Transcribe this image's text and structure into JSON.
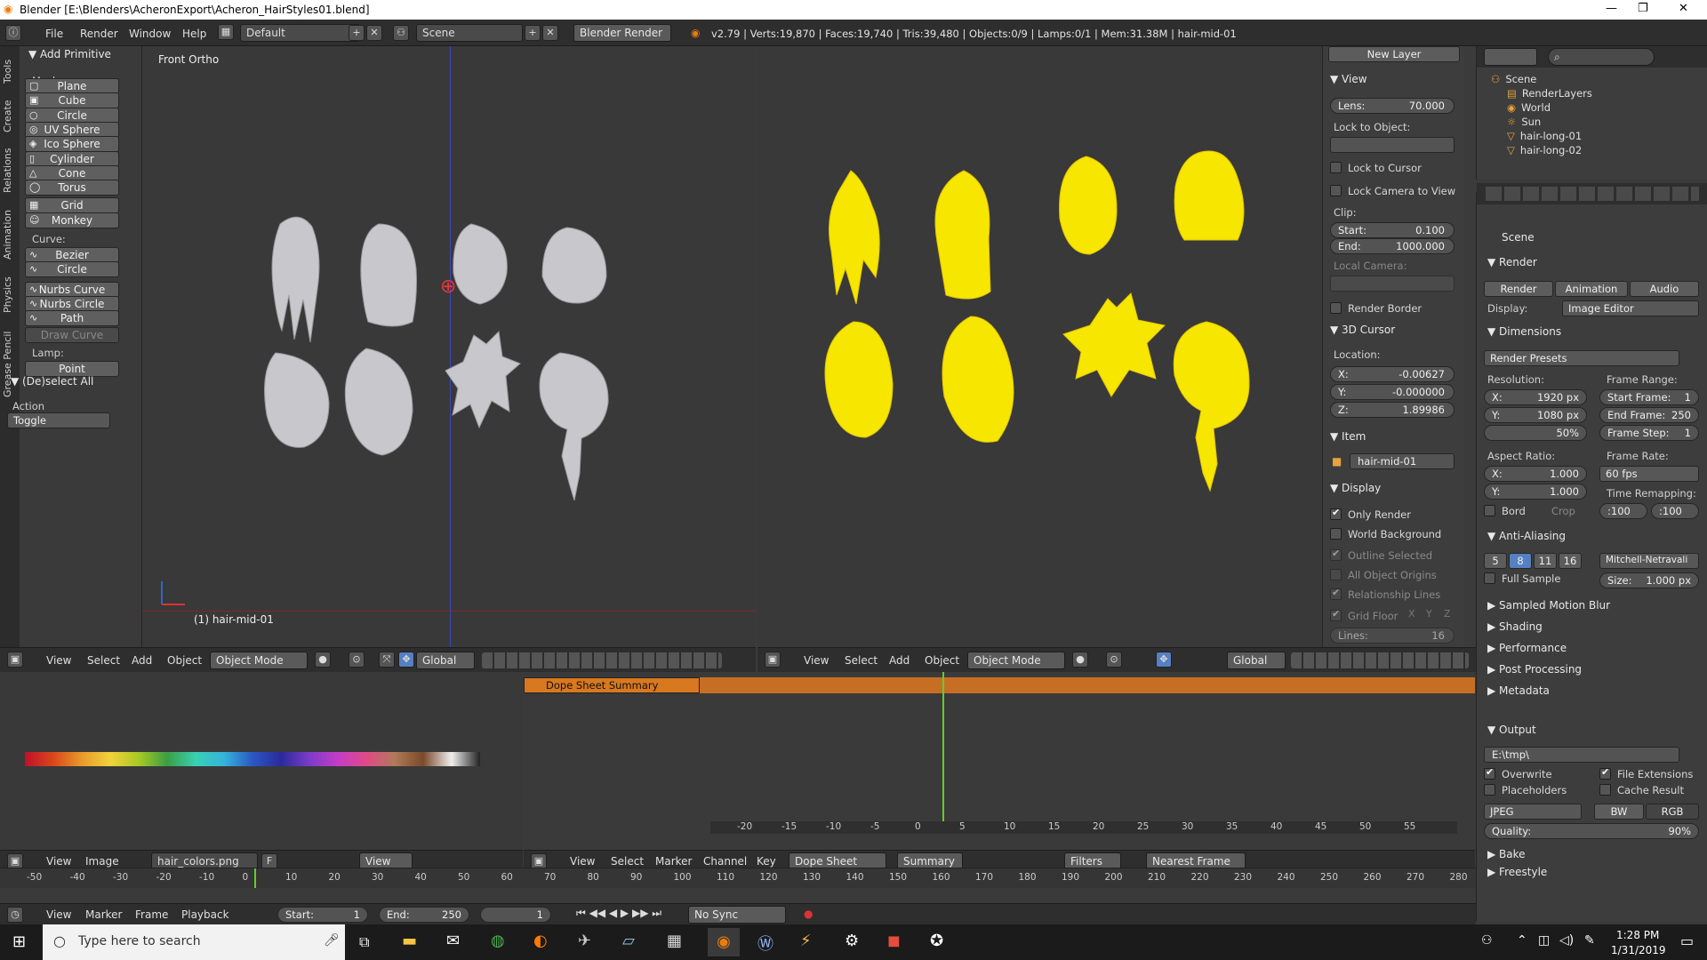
{
  "window": {
    "title": "Blender [E:\\Blenders\\AcheronExport\\Acheron_HairStyles01.blend]"
  },
  "topbar": {
    "menus": [
      "File",
      "Render",
      "Window",
      "Help"
    ],
    "layout": "Default",
    "scene": "Scene",
    "engine": "Blender Render",
    "stats": "v2.79 | Verts:19,870 | Faces:19,740 | Tris:39,480 | Objects:0/9 | Lamps:0/1 | Mem:31.38M | hair-mid-01"
  },
  "toolshelf": {
    "tabs": [
      "Tools",
      "Create",
      "Relations",
      "Animation",
      "Physics",
      "Grease Pencil"
    ],
    "panel_title": "Add Primitive",
    "mesh_label": "Mesh:",
    "mesh_items": [
      "Plane",
      "Cube",
      "Circle",
      "UV Sphere",
      "Ico Sphere",
      "Cylinder",
      "Cone",
      "Torus",
      "Grid",
      "Monkey"
    ],
    "curve_label": "Curve:",
    "curve_items": [
      "Bezier",
      "Circle",
      "Nurbs Curve",
      "Nurbs Circle",
      "Path"
    ],
    "draw_curve": "Draw Curve",
    "lamp_label": "Lamp:",
    "lamp_items": [
      "Point"
    ],
    "operator_title": "(De)select All",
    "action_label": "Action",
    "action_value": "Toggle"
  },
  "viewport_left": {
    "label": "Front Ortho",
    "object_label": "(1) hair-mid-01",
    "header": {
      "menus": [
        "View",
        "Select",
        "Add",
        "Object"
      ],
      "mode": "Object Mode",
      "orientation": "Global"
    }
  },
  "viewport_right": {
    "header": {
      "menus": [
        "View",
        "Select",
        "Add",
        "Object"
      ],
      "mode": "Object Mode",
      "orientation": "Global"
    }
  },
  "npanel": {
    "new_layer": "New Layer",
    "view_title": "View",
    "lens_label": "Lens:",
    "lens_value": "70.000",
    "lock_to_object": "Lock to Object:",
    "lock_to_cursor": "Lock to Cursor",
    "lock_camera": "Lock Camera to View",
    "clip_label": "Clip:",
    "clip_start_label": "Start:",
    "clip_start": "0.100",
    "clip_end_label": "End:",
    "clip_end": "1000.000",
    "local_camera": "Local Camera:",
    "render_border": "Render Border",
    "cursor_title": "3D Cursor",
    "location_label": "Location:",
    "cursor_x_label": "X:",
    "cursor_x": "-0.00627",
    "cursor_y_label": "Y:",
    "cursor_y": "-0.000000",
    "cursor_z_label": "Z:",
    "cursor_z": "1.89986",
    "item_title": "Item",
    "item_name": "hair-mid-01",
    "display_title": "Display",
    "only_render": "Only Render",
    "world_background": "World Background",
    "outline_selected": "Outline Selected",
    "all_object_origins": "All Object Origins",
    "relationship_lines": "Relationship Lines",
    "grid_floor": "Grid Floor",
    "grid_axes": [
      "X",
      "Y",
      "Z"
    ],
    "lines_label": "Lines:",
    "lines_value": "16"
  },
  "outliner": {
    "rows": [
      "Scene",
      "RenderLayers",
      "World",
      "Sun",
      "hair-long-01",
      "hair-long-02"
    ]
  },
  "properties": {
    "context": "Scene",
    "render_title": "Render",
    "render_tabs": [
      "Render",
      "Animation",
      "Audio"
    ],
    "display_label": "Display:",
    "display_value": "Image Editor",
    "dimensions_title": "Dimensions",
    "render_presets": "Render Presets",
    "resolution_label": "Resolution:",
    "res_x_label": "X:",
    "res_x": "1920 px",
    "res_y_label": "Y:",
    "res_y": "1080 px",
    "res_pct": "50%",
    "frame_range_label": "Frame Range:",
    "start_frame_label": "Start Frame:",
    "start_frame": "1",
    "end_frame_label": "End Frame:",
    "end_frame": "250",
    "frame_step_label": "Frame Step:",
    "frame_step": "1",
    "aspect_label": "Aspect Ratio:",
    "aspect_x_label": "X:",
    "aspect_x": "1.000",
    "aspect_y_label": "Y:",
    "aspect_y": "1.000",
    "frame_rate_label": "Frame Rate:",
    "frame_rate": "60 fps",
    "time_remap_label": "Time Remapping:",
    "time_remap_old": ":100",
    "time_remap_new": ":100",
    "bord": "Bord",
    "crop": "Crop",
    "aa_title": "Anti-Aliasing",
    "aa_samples": [
      "5",
      "8",
      "11",
      "16"
    ],
    "aa_filter": "Mitchell-Netravali",
    "full_sample": "Full Sample",
    "aa_size_label": "Size:",
    "aa_size": "1.000 px",
    "sections": [
      "Sampled Motion Blur",
      "Shading",
      "Performance",
      "Post Processing",
      "Metadata"
    ],
    "output_title": "Output",
    "output_path": "E:\\tmp\\",
    "overwrite": "Overwrite",
    "file_extensions": "File Extensions",
    "placeholders": "Placeholders",
    "cache_result": "Cache Result",
    "format": "JPEG",
    "bw": "BW",
    "rgb": "RGB",
    "quality_label": "Quality:",
    "quality": "90%",
    "bake": "Bake",
    "freestyle": "Freestyle"
  },
  "image_editor": {
    "header": {
      "menus": [
        "View",
        "Image"
      ],
      "image": "hair_colors.png",
      "f": "F",
      "view": "View"
    }
  },
  "dopesheet": {
    "summary_row": "Dope Sheet Summary",
    "ruler": [
      "-20",
      "-15",
      "-10",
      "-5",
      "0",
      "5",
      "10",
      "15",
      "20",
      "25",
      "30",
      "35",
      "40",
      "45",
      "50",
      "55"
    ],
    "current_frame": "1",
    "header": {
      "menus": [
        "View",
        "Select",
        "Marker",
        "Channel",
        "Key"
      ],
      "mode": "Dope Sheet",
      "summary": "Summary",
      "filters": "Filters",
      "snap": "Nearest Frame"
    }
  },
  "timeline": {
    "ruler": [
      "-50",
      "-40",
      "-30",
      "-20",
      "-10",
      "0",
      "10",
      "20",
      "30",
      "40",
      "50",
      "60",
      "70",
      "80",
      "90",
      "100",
      "110",
      "120",
      "130",
      "140",
      "150",
      "160",
      "170",
      "180",
      "190",
      "200",
      "210",
      "220",
      "230",
      "240",
      "250",
      "260",
      "270",
      "280"
    ],
    "menus": [
      "View",
      "Marker",
      "Frame",
      "Playback"
    ],
    "start_label": "Start:",
    "start": "1",
    "end_label": "End:",
    "end": "250",
    "current": "1",
    "sync": "No Sync"
  },
  "taskbar": {
    "search_placeholder": "Type here to search",
    "time": "1:28 PM",
    "date": "1/31/2019"
  }
}
